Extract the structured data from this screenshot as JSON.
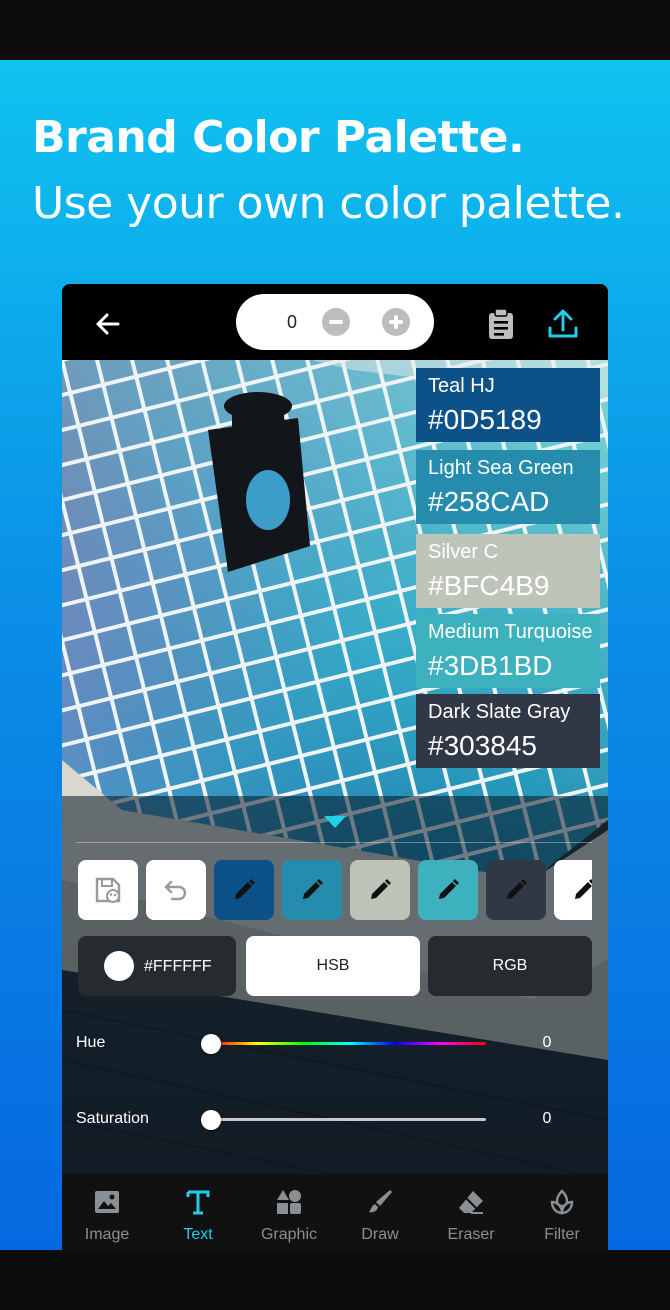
{
  "promo": {
    "headline": "Brand Color Palette.",
    "subline": "Use your own color palette."
  },
  "toolbar": {
    "counter_value": "0",
    "back_icon": "back-arrow-icon",
    "clipboard_icon": "clipboard-icon",
    "share_icon": "upload-share-icon"
  },
  "swatches": [
    {
      "name": "Teal HJ",
      "hex": "#0D5189",
      "color": "#0d5189"
    },
    {
      "name": "Light Sea Green",
      "hex": "#258CAD",
      "color": "#258cad"
    },
    {
      "name": "Silver C",
      "hex": "#BFC4B9",
      "color": "#bfc4b9"
    },
    {
      "name": "Medium Turquoise",
      "hex": "#3DB1BD",
      "color": "#3db1bd"
    },
    {
      "name": "Dark Slate Gray",
      "hex": "#303845",
      "color": "#303845"
    }
  ],
  "palette_buttons": {
    "save_palette_icon": "save-palette-icon",
    "undo_icon": "undo-icon",
    "edit_icon": "pencil-icon",
    "colors": [
      "#0d5189",
      "#258cad",
      "#bfc4b9",
      "#3db1bd",
      "#303845",
      "#ffffff"
    ]
  },
  "color_mode": {
    "current_hex": "#FFFFFF",
    "hsb_label": "HSB",
    "rgb_label": "RGB",
    "selected": "HSB"
  },
  "hue": {
    "label": "Hue",
    "value": "0"
  },
  "saturation": {
    "label": "Saturation",
    "value": "0"
  },
  "accent_color": "#1ed0e8",
  "nav": [
    {
      "label": "Image",
      "icon": "image-icon",
      "active": false
    },
    {
      "label": "Text",
      "icon": "text-icon",
      "active": true
    },
    {
      "label": "Graphic",
      "icon": "graphic-shapes-icon",
      "active": false
    },
    {
      "label": "Draw",
      "icon": "brush-icon",
      "active": false
    },
    {
      "label": "Eraser",
      "icon": "eraser-icon",
      "active": false
    },
    {
      "label": "Filter",
      "icon": "filter-flower-icon",
      "active": false
    }
  ]
}
